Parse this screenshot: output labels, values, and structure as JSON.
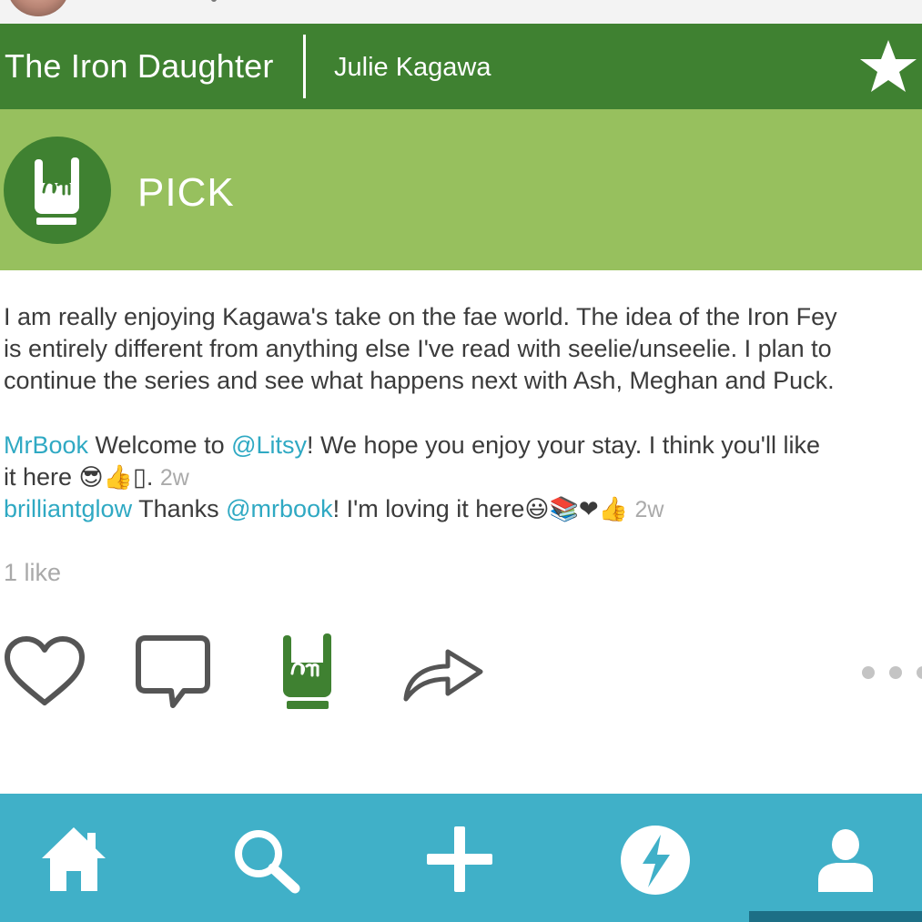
{
  "book": {
    "title": "The Iron Daughter",
    "author": "Julie Kagawa",
    "favorite_icon": "star-icon"
  },
  "post": {
    "type_label": "PICK",
    "type_icon": "rock-hand-icon",
    "review": [
      "I am really enjoying Kagawa's take on the fae world. The idea of the Iron Fey",
      "is entirely different from anything else I've read with seelie/unseelie. I plan to",
      "continue the series and see what happens next with Ash, Meghan and Puck."
    ],
    "likes": "1 like"
  },
  "comments": [
    {
      "user": "MrBook",
      "text_before": " Welcome to ",
      "mention": "@Litsy",
      "text_after_line1": "! We hope you enjoy your stay. I think you'll like",
      "text_line2": "it here ",
      "emojis": "😎👍",
      "trailing": "▯.",
      "time": "2w"
    },
    {
      "user": "brilliantglow",
      "text_before": " Thanks ",
      "mention": "@mrbook",
      "text_after": "! I'm loving it here",
      "emojis": "😃📚❤👍",
      "time": "2w"
    }
  ],
  "actions": [
    {
      "name": "like",
      "icon": "heart-icon"
    },
    {
      "name": "comment",
      "icon": "speech-bubble-icon"
    },
    {
      "name": "pick",
      "icon": "rock-hand-icon"
    },
    {
      "name": "share",
      "icon": "share-arrow-icon"
    },
    {
      "name": "more",
      "icon": "more-dots-icon"
    }
  ],
  "tabbar": [
    {
      "name": "home",
      "icon": "home-icon"
    },
    {
      "name": "search",
      "icon": "search-icon"
    },
    {
      "name": "add",
      "icon": "plus-icon"
    },
    {
      "name": "activity",
      "icon": "lightning-icon"
    },
    {
      "name": "profile",
      "icon": "profile-icon"
    }
  ],
  "colors": {
    "header_green": "#3f8131",
    "pick_green": "#97c05e",
    "link_blue": "#2fa9c3",
    "tabbar_blue": "#40b0c8"
  }
}
